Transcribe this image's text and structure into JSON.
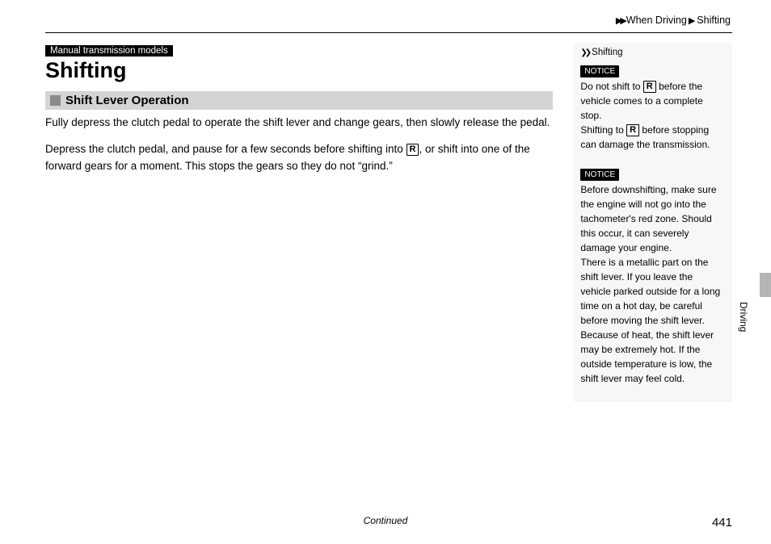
{
  "breadcrumb": {
    "item1": "When Driving",
    "item2": "Shifting"
  },
  "main": {
    "tag": "Manual transmission models",
    "title": "Shifting",
    "subheading": "Shift Lever Operation",
    "p1": "Fully depress the clutch pedal to operate the shift lever and change gears, then slowly release the pedal.",
    "p2a": "Depress the clutch pedal, and pause for a few seconds before shifting into ",
    "p2_gear": "R",
    "p2b": ", or shift into one of the forward gears for a moment. This stops the gears so they do not “grind.”"
  },
  "side": {
    "heading": "Shifting",
    "notice_label": "NOTICE",
    "n1a": "Do not shift to ",
    "n1_gear1": "R",
    "n1b": " before the vehicle comes to a complete stop.",
    "n1c_a": "Shifting to ",
    "n1_gear2": "R",
    "n1c_b": " before stopping can damage the transmission.",
    "n2": "Before downshifting, make sure the engine will not go into the tachometer's red zone. Should this occur, it can severely damage your engine.",
    "n3": "There is a metallic part on the shift lever. If you leave the vehicle parked outside for a long time on a hot day, be careful before moving the shift lever. Because of heat, the shift lever may be extremely hot. If the outside temperature is low, the shift lever may feel cold."
  },
  "footer": {
    "continued": "Continued",
    "page": "441"
  },
  "edge": {
    "label": "Driving"
  }
}
